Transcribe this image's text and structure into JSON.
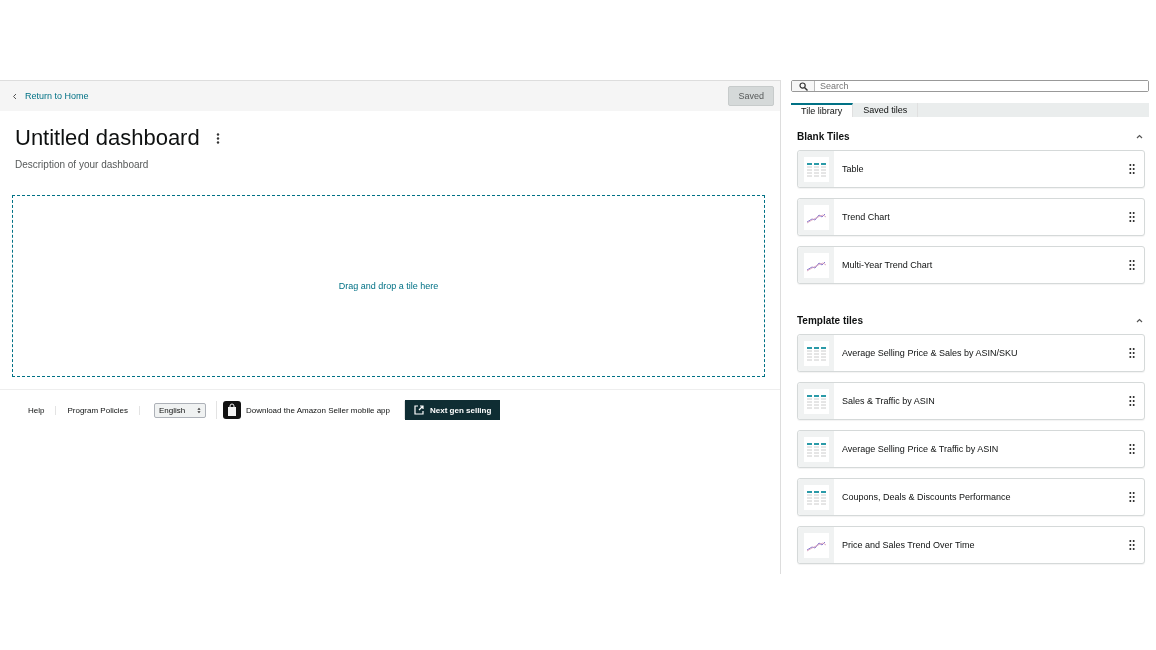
{
  "header": {
    "back_link": "Return to Home",
    "save_button": "Saved"
  },
  "dashboard": {
    "title": "Untitled dashboard",
    "description": "Description of your dashboard",
    "drop_hint": "Drag and drop a tile here"
  },
  "footer": {
    "links": [
      "Help",
      "Program Policies"
    ],
    "language": "English",
    "app_link": "Download the Amazon Seller mobile app",
    "next_gen_button": "Next gen selling"
  },
  "library": {
    "search": {
      "placeholder": "Search"
    },
    "tabs": [
      {
        "label": "Tile library",
        "selected": true
      },
      {
        "label": "Saved tiles",
        "selected": false
      }
    ],
    "sections": [
      {
        "title": "Blank Tiles",
        "expanded": true,
        "tiles": [
          {
            "kind": "table",
            "label": "Table"
          },
          {
            "kind": "trend",
            "label": "Trend Chart"
          },
          {
            "kind": "trend",
            "label": "Multi-Year Trend Chart"
          }
        ]
      },
      {
        "title": "Template tiles",
        "expanded": true,
        "tiles": [
          {
            "kind": "table",
            "label": "Average Selling Price & Sales by ASIN/SKU"
          },
          {
            "kind": "table",
            "label": "Sales & Traffic by ASIN"
          },
          {
            "kind": "table",
            "label": "Average Selling Price & Traffic by ASIN"
          },
          {
            "kind": "table",
            "label": "Coupons, Deals & Discounts Performance"
          },
          {
            "kind": "trend",
            "label": "Price and Sales Trend Over Time"
          }
        ]
      }
    ]
  }
}
